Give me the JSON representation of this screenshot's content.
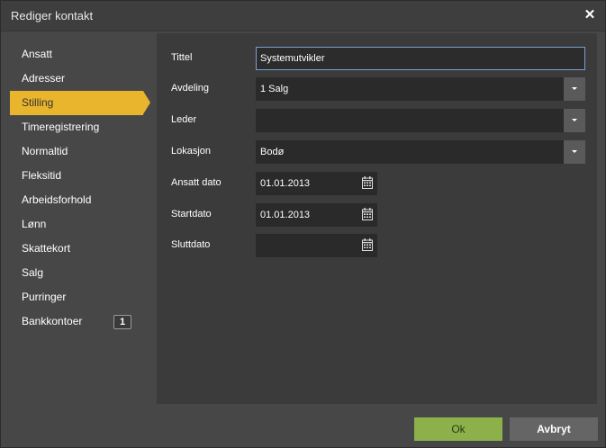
{
  "window": {
    "title": "Rediger kontakt"
  },
  "sidebar": {
    "items": [
      {
        "label": "Ansatt"
      },
      {
        "label": "Adresser"
      },
      {
        "label": "Stilling",
        "active": true
      },
      {
        "label": "Timeregistrering"
      },
      {
        "label": "Normaltid"
      },
      {
        "label": "Fleksitid"
      },
      {
        "label": "Arbeidsforhold"
      },
      {
        "label": "Lønn"
      },
      {
        "label": "Skattekort"
      },
      {
        "label": "Salg"
      },
      {
        "label": "Purringer"
      },
      {
        "label": "Bankkontoer",
        "badge": "1"
      }
    ]
  },
  "form": {
    "tittel": {
      "label": "Tittel",
      "value": "Systemutvikler"
    },
    "avdeling": {
      "label": "Avdeling",
      "value": "1 Salg"
    },
    "leder": {
      "label": "Leder",
      "value": ""
    },
    "lokasjon": {
      "label": "Lokasjon",
      "value": "Bodø"
    },
    "ansatt_dato": {
      "label": "Ansatt dato",
      "value": "01.01.2013"
    },
    "startdato": {
      "label": "Startdato",
      "value": "01.01.2013"
    },
    "sluttdato": {
      "label": "Sluttdato",
      "value": ""
    }
  },
  "buttons": {
    "ok": "Ok",
    "cancel": "Avbryt"
  },
  "colors": {
    "active_nav": "#e9b52c",
    "ok_button": "#8cb14a",
    "cancel_button": "#656565",
    "focus_border": "#7a9fcf"
  },
  "icons": {
    "close": "close-icon",
    "dropdown": "chevron-down-icon",
    "calendar": "calendar-icon"
  }
}
